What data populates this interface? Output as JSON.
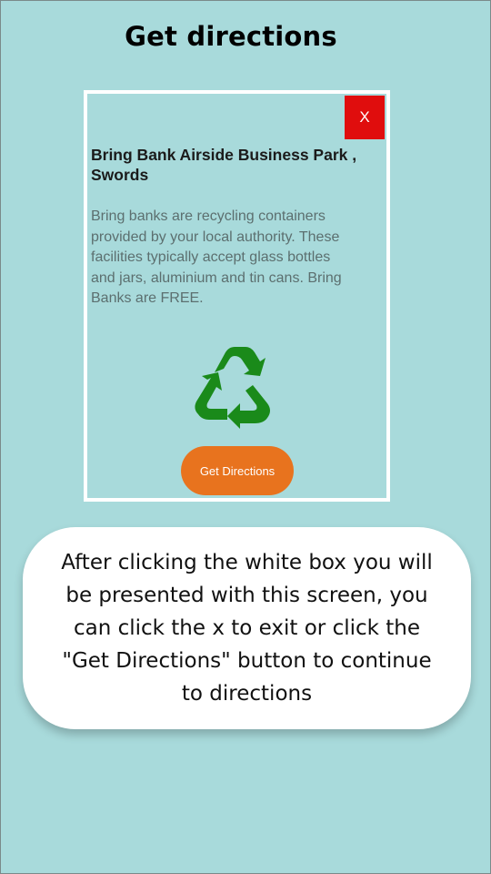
{
  "page": {
    "title": "Get directions",
    "background_color": "#a8dadb"
  },
  "popup": {
    "close_label": "X",
    "close_color": "#e00d0d",
    "title_lines": [
      "Bring Bank Airside Business Park ,",
      "Swords"
    ],
    "description_lines": [
      "Bring banks are recycling containers",
      "provided by your local authority. These",
      "facilities typically accept glass bottles",
      "and jars, aluminium and tin cans. Bring",
      "Banks are FREE."
    ],
    "icon": "recycle-icon",
    "icon_color": "#1a8a1a",
    "button_label": "Get Directions",
    "button_color": "#e8731e"
  },
  "caption": {
    "lines": [
      "After clicking the white box you will",
      "be presented with this screen, you",
      "can click the x to exit or click the",
      "\"Get Directions\" button to continue",
      "to directions"
    ]
  }
}
